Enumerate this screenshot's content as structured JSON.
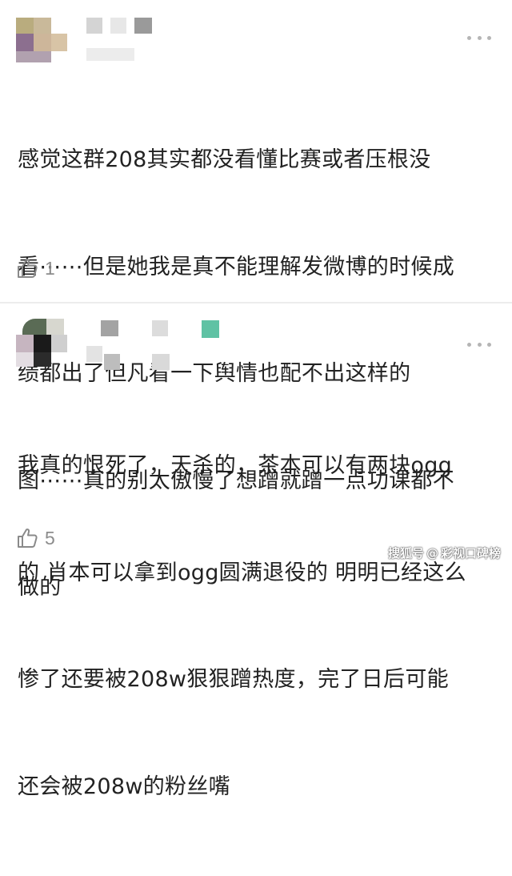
{
  "comments": [
    {
      "text_lines": [
        "感觉这群208其实都没看懂比赛或者压根没",
        "看⋯⋯但是她我是真不能理解发微博的时候成",
        "绩都出了但凡看一下舆情也配不出这样的",
        "图⋯⋯真的别太傲慢了想蹭就蹭一点功课都不",
        "做的"
      ],
      "like_count": "1",
      "like_icon": "thumbs-up-icon",
      "more_icon": "more-dots-icon"
    },
    {
      "text_lines": [
        "我真的恨死了，天杀的，茶本可以有两块ogg",
        "的 肖本可以拿到ogg圆满退役的 明明已经这么",
        "惨了还要被208w狠狠蹭热度，完了日后可能",
        "还会被208w的粉丝嘴"
      ],
      "like_count": "5",
      "like_icon": "thumbs-up-icon",
      "more_icon": "more-dots-icon"
    }
  ],
  "watermark": {
    "prefix": "搜狐号",
    "at": "@",
    "account": "彩视口碑榜"
  },
  "colors": {
    "text": "#222222",
    "muted": "#8c8c8c",
    "divider": "#ececec",
    "mosaic_accent": "#5fc2a4"
  }
}
